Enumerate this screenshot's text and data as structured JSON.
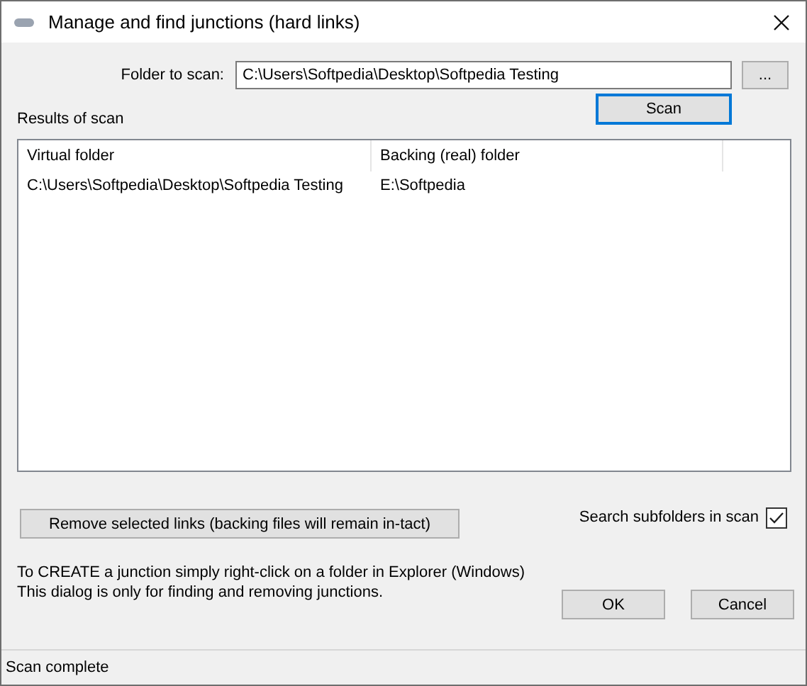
{
  "window": {
    "title": "Manage and find junctions (hard links)"
  },
  "folder": {
    "label": "Folder to scan:",
    "value": "C:\\Users\\Softpedia\\Desktop\\Softpedia Testing",
    "browse": "..."
  },
  "scan_button": "Scan",
  "results": {
    "label": "Results of scan",
    "columns": [
      "Virtual folder",
      "Backing (real) folder"
    ],
    "rows": [
      {
        "cells": [
          "C:\\Users\\Softpedia\\Desktop\\Softpedia Testing",
          "E:\\Softpedia"
        ],
        "selected": false
      }
    ]
  },
  "remove_button": "Remove selected links (backing files will remain in-tact)",
  "subfolders": {
    "label": "Search subfolders in scan",
    "checked": true
  },
  "info": [
    "To CREATE a junction simply right-click on a folder in Explorer (Windows)",
    "This dialog is only for finding and removing junctions."
  ],
  "buttons": [
    "OK",
    "Cancel"
  ],
  "status_bar": "Scan complete"
}
